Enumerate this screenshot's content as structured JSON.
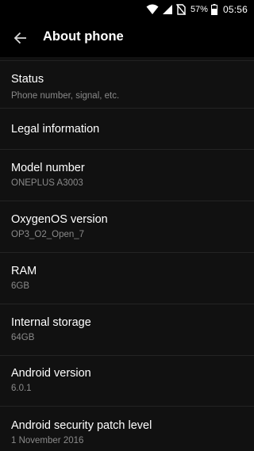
{
  "status_bar": {
    "battery_percent": "57%",
    "time": "05:56",
    "icons": [
      "wifi-icon",
      "signal-icon",
      "no-sim-icon",
      "battery-icon"
    ]
  },
  "toolbar": {
    "back_icon": "arrow-back-icon",
    "title": "About phone"
  },
  "items": [
    {
      "title": "Status",
      "summary": "Phone number, signal, etc."
    },
    {
      "title": "Legal information",
      "summary": ""
    },
    {
      "title": "Model number",
      "summary": "ONEPLUS A3003"
    },
    {
      "title": "OxygenOS version",
      "summary": "OP3_O2_Open_7"
    },
    {
      "title": "RAM",
      "summary": "6GB"
    },
    {
      "title": "Internal storage",
      "summary": "64GB"
    },
    {
      "title": "Android version",
      "summary": "6.0.1"
    },
    {
      "title": "Android security patch level",
      "summary": "1 November 2016"
    }
  ]
}
